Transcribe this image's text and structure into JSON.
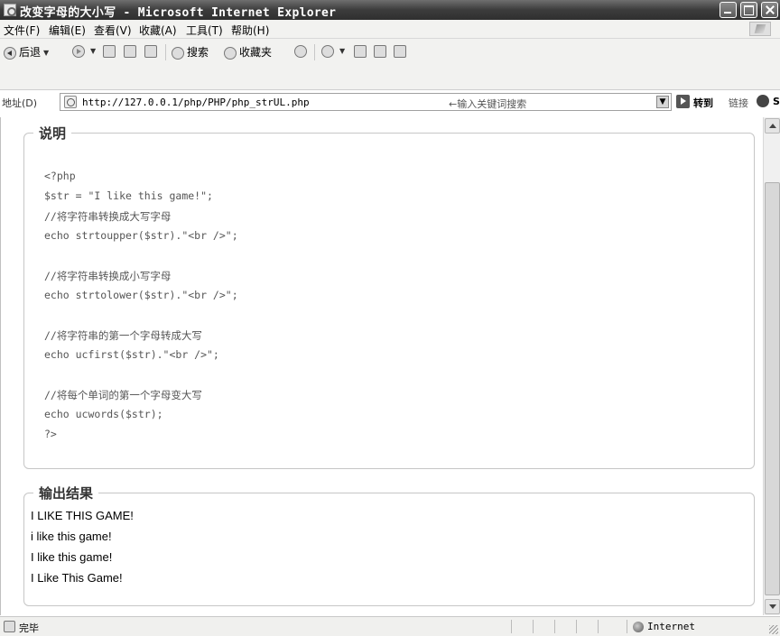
{
  "window": {
    "title": "改变字母的大小写 - Microsoft Internet Explorer"
  },
  "menu": [
    "文件(F)",
    "编辑(E)",
    "查看(V)",
    "收藏(A)",
    "工具(T)",
    "帮助(H)"
  ],
  "toolbar": {
    "back": "后退",
    "search": "搜索",
    "favorites": "收藏夹"
  },
  "address": {
    "label": "地址(D)",
    "url": "http://127.0.0.1/php/PHP/php_strUL.php",
    "search_hint": "←输入关键词搜索",
    "go": "转到",
    "links": "链接",
    "snagit": "SnagIt"
  },
  "explain": {
    "legend": "说明",
    "code": [
      "<?php",
      "$str = \"I like this game!\";",
      "//将字符串转换成大写字母",
      "echo strtoupper($str).\"<br />\";",
      "",
      "//将字符串转换成小写字母",
      "echo strtolower($str).\"<br />\";",
      "",
      "//将字符串的第一个字母转成大写",
      "echo ucfirst($str).\"<br />\";",
      "",
      "//将每个单词的第一个字母变大写",
      "echo ucwords($str);",
      "?>"
    ]
  },
  "output": {
    "legend": "输出结果",
    "lines": [
      "I LIKE THIS GAME!",
      "i like this game!",
      "I like this game!",
      "I Like This Game!"
    ]
  },
  "status": {
    "text": "完毕",
    "zone": "Internet"
  }
}
